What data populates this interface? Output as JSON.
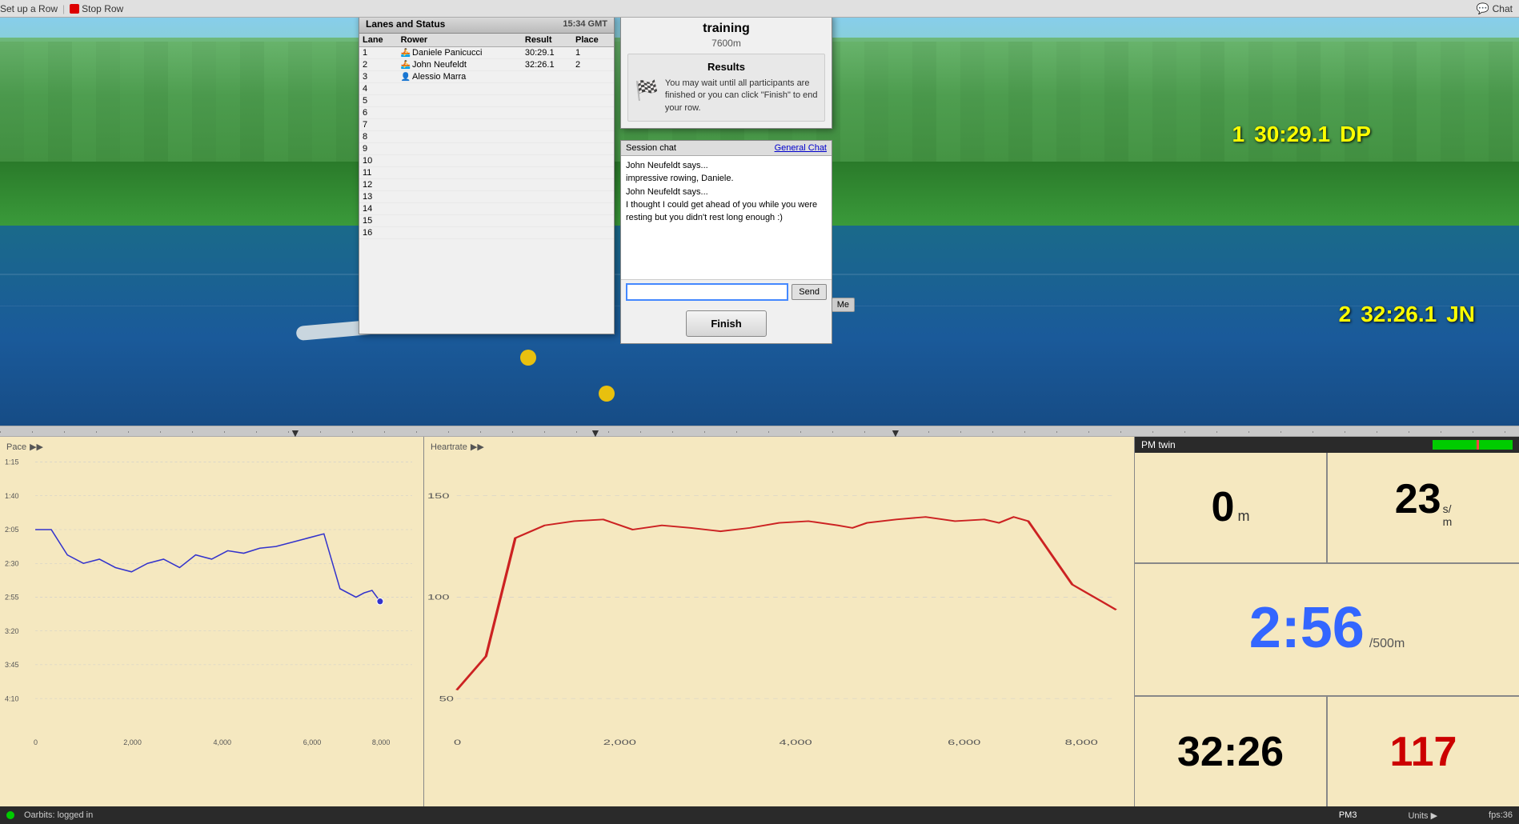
{
  "topbar": {
    "setup_row": "Set up a Row",
    "stop_row": "Stop Row",
    "chat_label": "Chat"
  },
  "lanes_dialog": {
    "title": "Lanes and Status",
    "time": "15:34 GMT",
    "columns": [
      "Lane",
      "Rower",
      "Result",
      "Place"
    ],
    "rows": [
      {
        "lane": "1",
        "rower": "Daniele Panicucci",
        "result": "30:29.1",
        "place": "1",
        "icon": "🚣"
      },
      {
        "lane": "2",
        "rower": "John Neufeldt",
        "result": "32:26.1",
        "place": "2",
        "icon": "🚣"
      },
      {
        "lane": "3",
        "rower": "Alessio Marra",
        "result": "",
        "place": "",
        "icon": "👤"
      },
      {
        "lane": "4",
        "rower": "",
        "result": "",
        "place": ""
      },
      {
        "lane": "5",
        "rower": "",
        "result": "",
        "place": ""
      },
      {
        "lane": "6",
        "rower": "",
        "result": "",
        "place": ""
      },
      {
        "lane": "7",
        "rower": "",
        "result": "",
        "place": ""
      },
      {
        "lane": "8",
        "rower": "",
        "result": "",
        "place": ""
      },
      {
        "lane": "9",
        "rower": "",
        "result": "",
        "place": ""
      },
      {
        "lane": "10",
        "rower": "",
        "result": "",
        "place": ""
      },
      {
        "lane": "11",
        "rower": "",
        "result": "",
        "place": ""
      },
      {
        "lane": "12",
        "rower": "",
        "result": "",
        "place": ""
      },
      {
        "lane": "13",
        "rower": "",
        "result": "",
        "place": ""
      },
      {
        "lane": "14",
        "rower": "",
        "result": "",
        "place": ""
      },
      {
        "lane": "15",
        "rower": "",
        "result": "",
        "place": ""
      },
      {
        "lane": "16",
        "rower": "",
        "result": "",
        "place": ""
      }
    ]
  },
  "results_dialog": {
    "title": "training",
    "distance": "7600m",
    "results_heading": "Results",
    "results_text": "You may wait until all participants are finished or you can click \"Finish\" to end your row."
  },
  "session_chat": {
    "label": "Session chat",
    "general_chat": "General Chat",
    "messages": [
      {
        "text": "John Neufeldt says..."
      },
      {
        "text": "    impressive rowing, Daniele."
      },
      {
        "text": "John Neufeldt says..."
      },
      {
        "text": "    I thought I could get ahead of you while you were resting but you didn't rest long enough :)"
      }
    ],
    "input_placeholder": "",
    "send_label": "Send",
    "finish_label": "Finish"
  },
  "scores": {
    "place1": "1",
    "time1": "30:29.1",
    "initials1": "DP",
    "place2": "2",
    "time2": "32:26.1",
    "initials2": "JN",
    "me_label": "Me"
  },
  "pace_chart": {
    "title": "Pace",
    "y_labels": [
      "1:15",
      "1:40",
      "2:05",
      "2:30",
      "2:55",
      "3:20",
      "3:45",
      "4:10"
    ],
    "x_labels": [
      "0",
      "2,000",
      "4,000",
      "6,000",
      "8,000"
    ]
  },
  "hr_chart": {
    "title": "Heartrate",
    "y_labels": [
      "150",
      "100",
      "50"
    ],
    "x_labels": [
      "0",
      "2,000",
      "4,000",
      "6,000",
      "8,000"
    ]
  },
  "pm_panel": {
    "title": "PM twin",
    "distance_value": "0",
    "distance_unit": "m",
    "spm_value": "23",
    "spm_unit": "s/",
    "spm_unit2": "m",
    "pace_value": "2:56",
    "pace_unit": "/500m",
    "time_value": "32:26",
    "hr_value": "117"
  },
  "status_bar": {
    "oarbits_label": "Oarbits: logged in",
    "pm3_label": "PM3",
    "units_label": "Units ▶",
    "fps_label": "fps:36"
  }
}
